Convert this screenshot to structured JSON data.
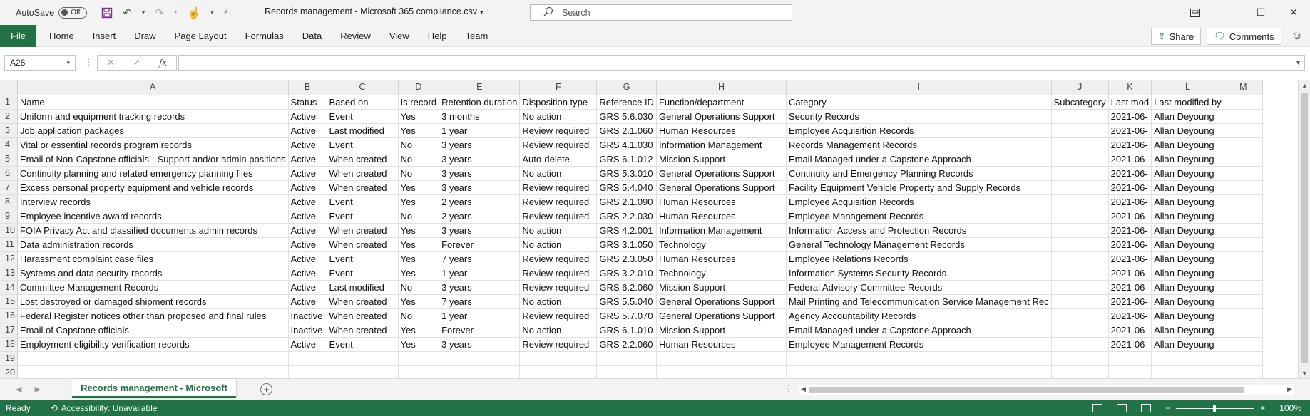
{
  "titlebar": {
    "autosave_label": "AutoSave",
    "autosave_state": "Off",
    "doc_title": "Records management - Microsoft 365 compliance.csv",
    "search_placeholder": "Search"
  },
  "ribbon": {
    "file": "File",
    "tabs": [
      "Home",
      "Insert",
      "Draw",
      "Page Layout",
      "Formulas",
      "Data",
      "Review",
      "View",
      "Help",
      "Team"
    ],
    "share": "Share",
    "comments": "Comments"
  },
  "formula_bar": {
    "name_box": "A28",
    "formula": ""
  },
  "columns": [
    "A",
    "B",
    "C",
    "D",
    "E",
    "F",
    "G",
    "H",
    "I",
    "J",
    "K",
    "L",
    "M"
  ],
  "rows": [
    [
      "Name",
      "Status",
      "Based on",
      "Is record",
      "Retention duration",
      "Disposition type",
      "Reference ID",
      "Function/department",
      "Category",
      "Subcategory",
      "Last mod",
      "Last modified by",
      ""
    ],
    [
      "Uniform and equipment tracking records",
      "Active",
      "Event",
      "Yes",
      "3 months",
      "No action",
      "GRS 5.6.030",
      "General Operations Support",
      "Security Records",
      "",
      "2021-06-",
      "Allan Deyoung",
      ""
    ],
    [
      "Job application packages",
      "Active",
      "Last modified",
      "Yes",
      "1 year",
      "Review required",
      "GRS 2.1.060",
      "Human Resources",
      "Employee Acquisition Records",
      "",
      "2021-06-",
      "Allan Deyoung",
      ""
    ],
    [
      "Vital or essential records program records",
      "Active",
      "Event",
      "No",
      "3 years",
      "Review required",
      "GRS 4.1.030",
      "Information Management",
      "Records Management Records",
      "",
      "2021-06-",
      "Allan Deyoung",
      ""
    ],
    [
      "Email of Non-Capstone officials - Support and/or admin positions",
      "Active",
      "When created",
      "No",
      "3 years",
      "Auto-delete",
      "GRS 6.1.012",
      "Mission Support",
      "Email Managed under a Capstone Approach",
      "",
      "2021-06-",
      "Allan Deyoung",
      ""
    ],
    [
      "Continuity planning and related emergency planning files",
      "Active",
      "When created",
      "No",
      "3 years",
      "No action",
      "GRS 5.3.010",
      "General Operations Support",
      "Continuity and Emergency Planning Records",
      "",
      "2021-06-",
      "Allan Deyoung",
      ""
    ],
    [
      "Excess personal property equipment and vehicle records",
      "Active",
      "When created",
      "Yes",
      "3 years",
      "Review required",
      "GRS 5.4.040",
      "General Operations Support",
      "Facility Equipment Vehicle Property and Supply Records",
      "",
      "2021-06-",
      "Allan Deyoung",
      ""
    ],
    [
      "Interview records",
      "Active",
      "Event",
      "Yes",
      "2 years",
      "Review required",
      "GRS 2.1.090",
      "Human Resources",
      "Employee Acquisition Records",
      "",
      "2021-06-",
      "Allan Deyoung",
      ""
    ],
    [
      "Employee incentive award records",
      "Active",
      "Event",
      "No",
      "2 years",
      "Review required",
      "GRS 2.2.030",
      "Human Resources",
      "Employee Management Records",
      "",
      "2021-06-",
      "Allan Deyoung",
      ""
    ],
    [
      "FOIA Privacy Act and classified documents admin records",
      "Active",
      "When created",
      "Yes",
      "3 years",
      "No action",
      "GRS 4.2.001",
      "Information Management",
      "Information Access and Protection Records",
      "",
      "2021-06-",
      "Allan Deyoung",
      ""
    ],
    [
      "Data administration records",
      "Active",
      "When created",
      "Yes",
      "Forever",
      "No action",
      "GRS 3.1.050",
      "Technology",
      "General Technology Management Records",
      "",
      "2021-06-",
      "Allan Deyoung",
      ""
    ],
    [
      "Harassment complaint case files",
      "Active",
      "Event",
      "Yes",
      "7 years",
      "Review required",
      "GRS 2.3.050",
      "Human Resources",
      "Employee Relations Records",
      "",
      "2021-06-",
      "Allan Deyoung",
      ""
    ],
    [
      "Systems and data security records",
      "Active",
      "Event",
      "Yes",
      "1 year",
      "Review required",
      "GRS 3.2.010",
      "Technology",
      "Information Systems Security Records",
      "",
      "2021-06-",
      "Allan Deyoung",
      ""
    ],
    [
      "Committee Management Records",
      "Active",
      "Last modified",
      "No",
      "3 years",
      "Review required",
      "GRS 6.2.060",
      "Mission Support",
      "Federal Advisory Committee Records",
      "",
      "2021-06-",
      "Allan Deyoung",
      ""
    ],
    [
      "Lost destroyed or damaged shipment records",
      "Active",
      "When created",
      "Yes",
      "7 years",
      "No action",
      "GRS 5.5.040",
      "General Operations Support",
      "Mail Printing and Telecommunication Service Management Rec",
      "",
      "2021-06-",
      "Allan Deyoung",
      ""
    ],
    [
      "Federal Register notices other than proposed and final rules",
      "Inactive",
      "When created",
      "No",
      "1 year",
      "Review required",
      "GRS 5.7.070",
      "General Operations Support",
      "Agency Accountability Records",
      "",
      "2021-06-",
      "Allan Deyoung",
      ""
    ],
    [
      "Email of Capstone officials",
      "Inactive",
      "When created",
      "Yes",
      "Forever",
      "No action",
      "GRS 6.1.010",
      "Mission Support",
      "Email Managed under a Capstone Approach",
      "",
      "2021-06-",
      "Allan Deyoung",
      ""
    ],
    [
      "Employment eligibility verification records",
      "Active",
      "Event",
      "Yes",
      "3 years",
      "Review required",
      "GRS 2.2.060",
      "Human Resources",
      "Employee Management Records",
      "",
      "2021-06-",
      "Allan Deyoung",
      ""
    ],
    [
      "",
      "",
      "",
      "",
      "",
      "",
      "",
      "",
      "",
      "",
      "",
      "",
      ""
    ],
    [
      "",
      "",
      "",
      "",
      "",
      "",
      "",
      "",
      "",
      "",
      "",
      "",
      ""
    ]
  ],
  "sheet_tab": "Records management - Microsoft",
  "status": {
    "ready": "Ready",
    "accessibility": "Accessibility: Unavailable",
    "zoom": "100%"
  }
}
